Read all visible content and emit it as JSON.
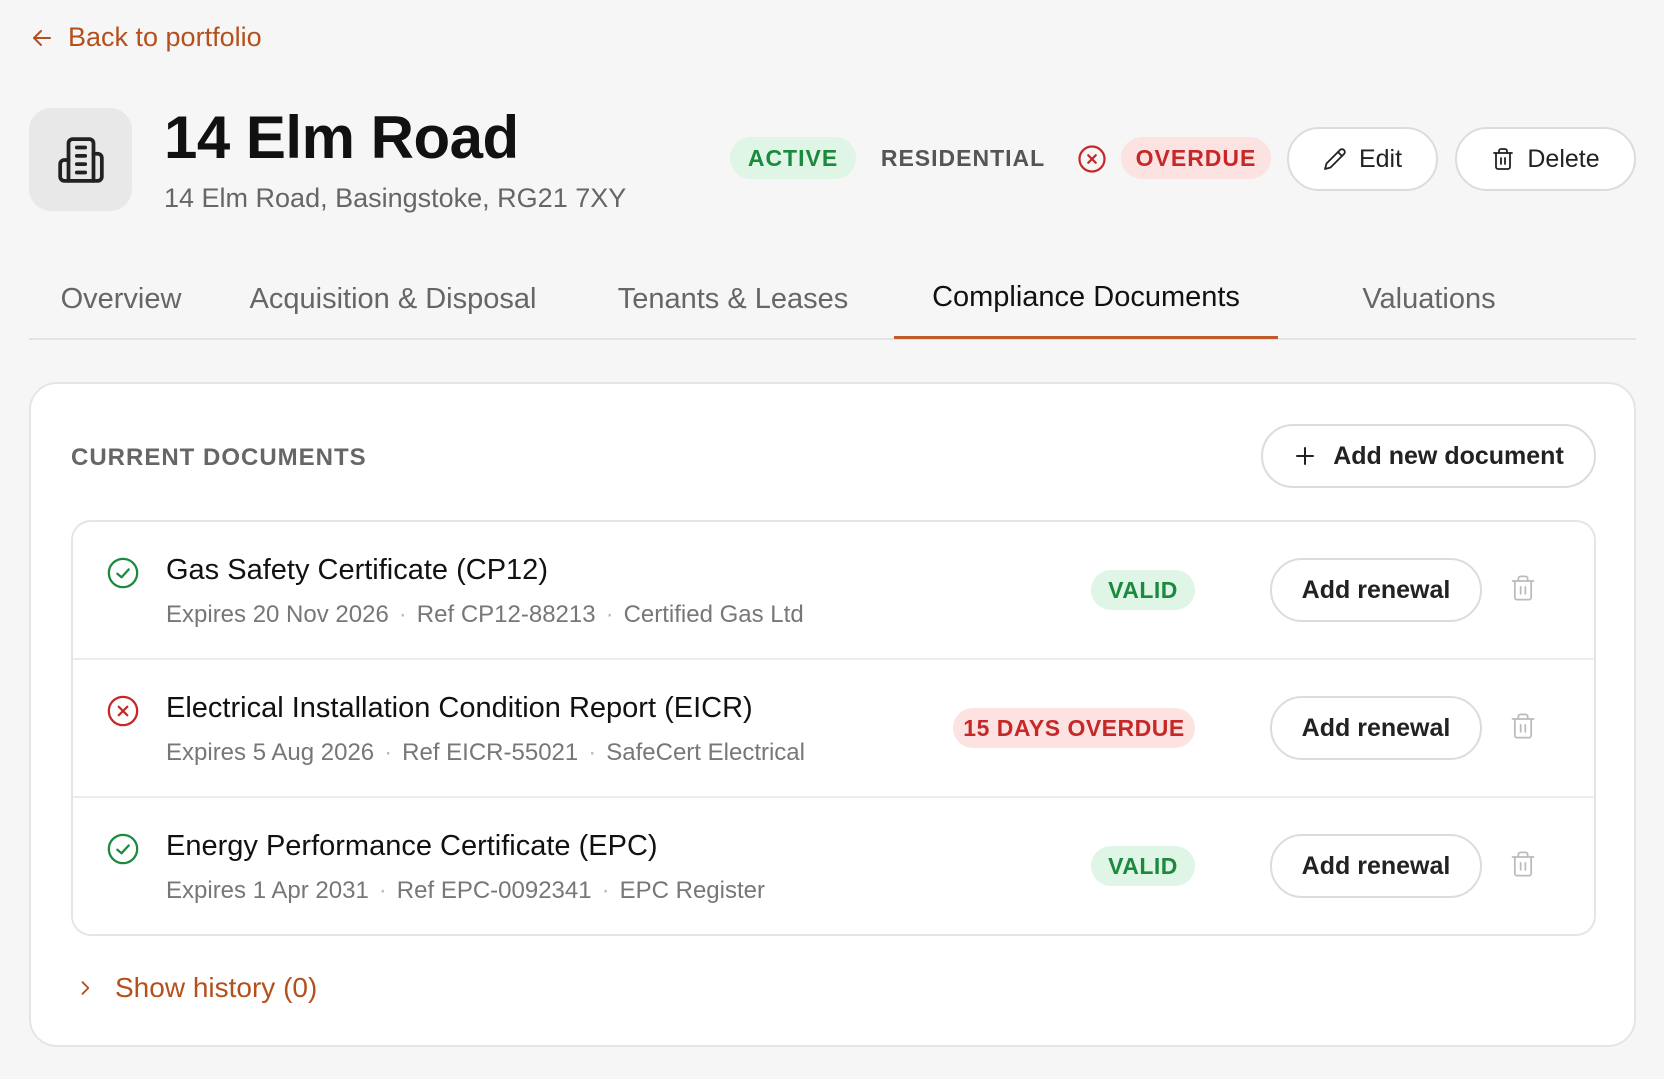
{
  "nav": {
    "back_label": "Back to portfolio"
  },
  "property": {
    "name": "14 Elm Road",
    "address": "14 Elm Road, Basingstoke, RG21 7XY",
    "status": "ACTIVE",
    "type": "RESIDENTIAL",
    "compliance": "OVERDUE"
  },
  "actions": {
    "edit_label": "Edit",
    "delete_label": "Delete"
  },
  "tabs": [
    {
      "label": "Overview"
    },
    {
      "label": "Acquisition & Disposal"
    },
    {
      "label": "Tenants & Leases"
    },
    {
      "label": "Compliance Documents",
      "active": true
    },
    {
      "label": "Valuations"
    }
  ],
  "documents": {
    "section_title": "CURRENT DOCUMENTS",
    "add_label": "Add new document",
    "renew_label": "Add renewal",
    "items": [
      {
        "name": "Gas Safety Certificate (CP12)",
        "expires": "Expires 20 Nov 2026",
        "ref": "Ref CP12-88213",
        "provider": "Certified Gas Ltd",
        "status": "VALID"
      },
      {
        "name": "Electrical Installation Condition Report (EICR)",
        "expires": "Expires 5 Aug 2026",
        "ref": "Ref EICR-55021",
        "provider": "SafeCert Electrical",
        "status": "15 DAYS OVERDUE"
      },
      {
        "name": "Energy Performance Certificate (EPC)",
        "expires": "Expires 1 Apr 2031",
        "ref": "Ref EPC-0092341",
        "provider": "EPC Register",
        "status": "VALID"
      }
    ],
    "history_label": "Show history (0)"
  },
  "colors": {
    "accent": "#b4501c",
    "valid_bg": "#dff5e6",
    "valid_text": "#1b8a3e",
    "overdue_bg": "#fde2e2",
    "overdue_text": "#c62828"
  }
}
